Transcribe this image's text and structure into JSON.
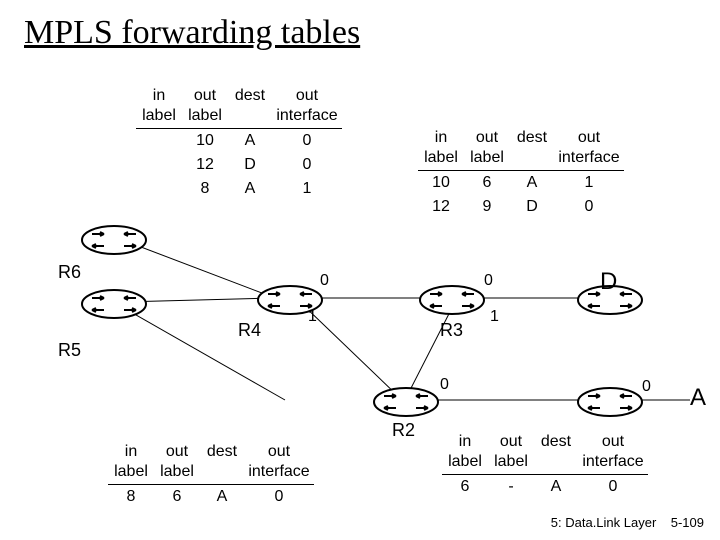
{
  "title": "MPLS forwarding tables",
  "headers": {
    "in_label": "in\nlabel",
    "out_label": "out\nlabel",
    "dest": "dest",
    "out_interface": "out\ninterface"
  },
  "tables": {
    "t1": {
      "rows": [
        {
          "in": "",
          "out": "10",
          "dest": "A",
          "oif": "0"
        },
        {
          "in": "",
          "out": "12",
          "dest": "D",
          "oif": "0"
        },
        {
          "in": "",
          "out": "8",
          "dest": "A",
          "oif": "1"
        }
      ]
    },
    "t2": {
      "rows": [
        {
          "in": "10",
          "out": "6",
          "dest": "A",
          "oif": "1"
        },
        {
          "in": "12",
          "out": "9",
          "dest": "D",
          "oif": "0"
        }
      ]
    },
    "t3": {
      "rows": [
        {
          "in": "8",
          "out": "6",
          "dest": "A",
          "oif": "0"
        }
      ]
    },
    "t4": {
      "rows": [
        {
          "in": "6",
          "out": "-",
          "dest": "A",
          "oif": "0"
        }
      ]
    }
  },
  "routers": {
    "r6": "R6",
    "r5": "R5",
    "r4": "R4",
    "r3": "R3",
    "r2": "R2"
  },
  "dests": {
    "d": "D",
    "a": "A"
  },
  "ports": {
    "r4_0": "0",
    "r4_1": "1",
    "r3_0": "0",
    "r3_1": "1",
    "r2_0": "0",
    "ra_0": "0"
  },
  "footer": {
    "chapter": "5: Data.Link Layer",
    "page": "5-109"
  }
}
